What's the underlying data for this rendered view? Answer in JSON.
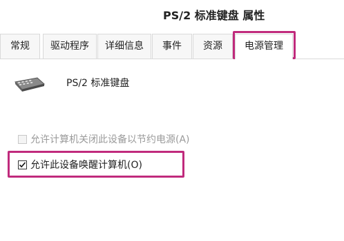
{
  "window": {
    "title": "PS/2 标准键盘 属性"
  },
  "tabs": [
    {
      "label": "常规"
    },
    {
      "label": "驱动程序"
    },
    {
      "label": "详细信息"
    },
    {
      "label": "事件"
    },
    {
      "label": "资源"
    },
    {
      "label": "电源管理",
      "active": true
    }
  ],
  "device": {
    "name": "PS/2 标准键盘",
    "icon": "keyboard-icon"
  },
  "options": [
    {
      "label": "允许计算机关闭此设备以节约电源(A)",
      "checked": false,
      "enabled": false
    },
    {
      "label": "允许此设备唤醒计算机(O)",
      "checked": true,
      "enabled": true
    }
  ],
  "colors": {
    "highlight": "#c02a7c",
    "tab_border": "#d9d9d9",
    "disabled_text": "#9a9a9a"
  }
}
